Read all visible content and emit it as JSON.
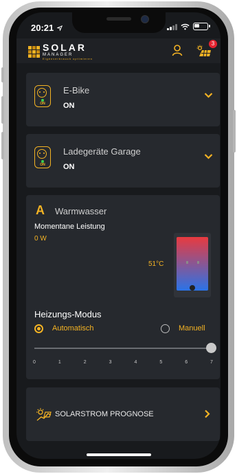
{
  "status_bar": {
    "time": "20:21"
  },
  "header": {
    "logo_title": "SOLAR",
    "logo_title_2": "MANAGER",
    "logo_subtitle": "Eigenverbrauch optimieren",
    "notification_count": "3"
  },
  "devices": [
    {
      "name": "E-Bike",
      "state": "ON",
      "plug_label": "ON"
    },
    {
      "name": "Ladegeräte Garage",
      "state": "ON",
      "plug_label": "ON"
    }
  ],
  "warmwasser": {
    "icon_letter": "A",
    "title": "Warmwasser",
    "power_label": "Momentane Leistung",
    "power_value": "0 W",
    "temperature": "51°C",
    "mode_title": "Heizungs-Modus",
    "mode_auto": "Automatisch",
    "mode_manual": "Manuell",
    "selected_mode": "Automatisch",
    "slider_ticks": [
      "0",
      "1",
      "2",
      "3",
      "4",
      "5",
      "6",
      "7"
    ],
    "slider_value": 7
  },
  "forecast": {
    "label": "SOLARSTROM PROGNOSE"
  },
  "colors": {
    "accent": "#f4b324",
    "background": "#181a1d",
    "card": "#26292e"
  }
}
